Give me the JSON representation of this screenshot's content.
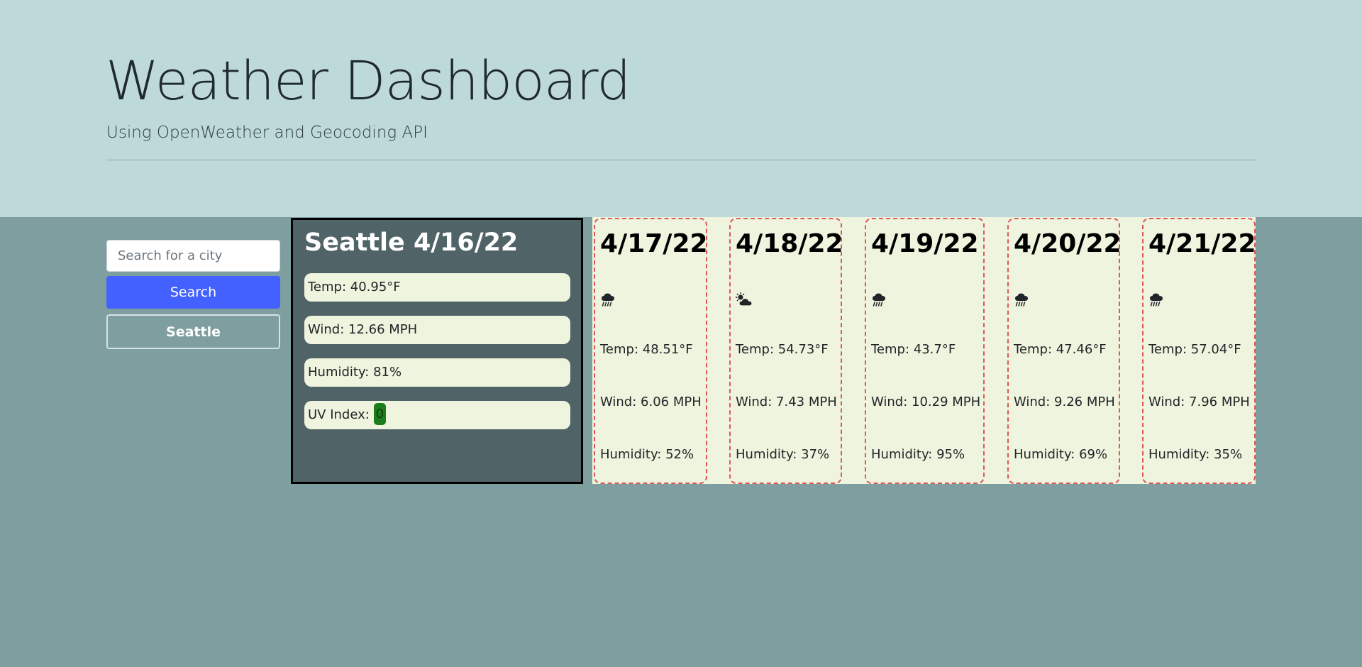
{
  "header": {
    "title": "Weather Dashboard",
    "subtitle": "Using OpenWeather and Geocoding API"
  },
  "search": {
    "placeholder": "Search for a city",
    "button_label": "Search",
    "history": [
      "Seattle"
    ]
  },
  "current": {
    "title": "Seattle 4/16/22",
    "temp": "Temp: 40.95°F",
    "wind": "Wind: 12.66 MPH",
    "humidity": "Humidity: 81%",
    "uv_label": "UV Index: ",
    "uv_value": "0",
    "uv_color": "#1b7e1b"
  },
  "forecast": [
    {
      "date": "4/17/22",
      "icon": "rain-cloud-icon",
      "temp": "Temp: 48.51°F",
      "wind": "Wind: 6.06 MPH",
      "humidity": "Humidity: 52%"
    },
    {
      "date": "4/18/22",
      "icon": "partly-cloudy-icon",
      "temp": "Temp: 54.73°F",
      "wind": "Wind: 7.43 MPH",
      "humidity": "Humidity: 37%"
    },
    {
      "date": "4/19/22",
      "icon": "rain-cloud-icon",
      "temp": "Temp: 43.7°F",
      "wind": "Wind: 10.29 MPH",
      "humidity": "Humidity: 95%"
    },
    {
      "date": "4/20/22",
      "icon": "rain-cloud-icon",
      "temp": "Temp: 47.46°F",
      "wind": "Wind: 9.26 MPH",
      "humidity": "Humidity: 69%"
    },
    {
      "date": "4/21/22",
      "icon": "rain-cloud-icon",
      "temp": "Temp: 57.04°F",
      "wind": "Wind: 7.96 MPH",
      "humidity": "Humidity: 35%"
    }
  ]
}
